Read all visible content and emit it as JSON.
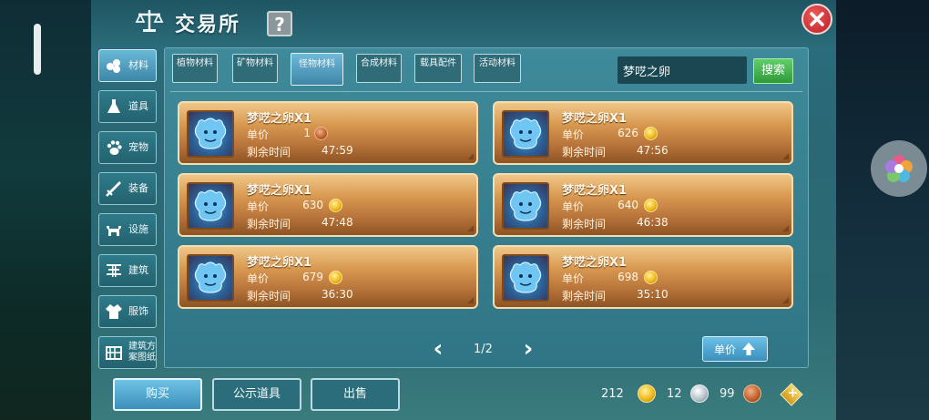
{
  "header": {
    "title": "交易所",
    "help_label": "?"
  },
  "sidebar": {
    "items": [
      {
        "label": "材料",
        "icon": "materials-icon",
        "active": true
      },
      {
        "label": "道具",
        "icon": "potion-icon",
        "active": false
      },
      {
        "label": "宠物",
        "icon": "paw-icon",
        "active": false
      },
      {
        "label": "装备",
        "icon": "sword-icon",
        "active": false
      },
      {
        "label": "设施",
        "icon": "animal-icon",
        "active": false
      },
      {
        "label": "建筑",
        "icon": "building-icon",
        "active": false
      },
      {
        "label": "服饰",
        "icon": "clothing-icon",
        "active": false
      },
      {
        "label": "建筑方案图纸",
        "icon": "blueprint-icon",
        "active": false
      }
    ]
  },
  "tabs": [
    {
      "label": "植物材料",
      "active": false
    },
    {
      "label": "矿物材料",
      "active": false
    },
    {
      "label": "怪物材料",
      "active": true
    },
    {
      "label": "合成材料",
      "active": false
    },
    {
      "label": "载具配件",
      "active": false
    },
    {
      "label": "活动材料",
      "active": false
    }
  ],
  "search": {
    "value": "梦呓之卵",
    "button_label": "搜索"
  },
  "listings": [
    {
      "name": "梦呓之卵X1",
      "price_label": "单价",
      "price": "1",
      "currency": "copper",
      "time_label": "剩余时间",
      "time": "47:59"
    },
    {
      "name": "梦呓之卵X1",
      "price_label": "单价",
      "price": "626",
      "currency": "gold",
      "time_label": "剩余时间",
      "time": "47:56"
    },
    {
      "name": "梦呓之卵X1",
      "price_label": "单价",
      "price": "630",
      "currency": "gold",
      "time_label": "剩余时间",
      "time": "47:48"
    },
    {
      "name": "梦呓之卵X1",
      "price_label": "单价",
      "price": "640",
      "currency": "gold",
      "time_label": "剩余时间",
      "time": "46:38"
    },
    {
      "name": "梦呓之卵X1",
      "price_label": "单价",
      "price": "679",
      "currency": "gold",
      "time_label": "剩余时间",
      "time": "36:30"
    },
    {
      "name": "梦呓之卵X1",
      "price_label": "单价",
      "price": "698",
      "currency": "gold",
      "time_label": "剩余时间",
      "time": "35:10"
    }
  ],
  "pager": {
    "text": "1/2"
  },
  "sort": {
    "label": "单价"
  },
  "actions": {
    "buy": "购买",
    "public_items": "公示道具",
    "sell": "出售"
  },
  "wallet": {
    "gold": "212",
    "silver": "12",
    "copper": "99"
  },
  "colors": {
    "card_top": "#f0c788",
    "card_bottom": "#8d5424",
    "accent_green": "#2f9a3a",
    "close_red": "#b81f24"
  }
}
